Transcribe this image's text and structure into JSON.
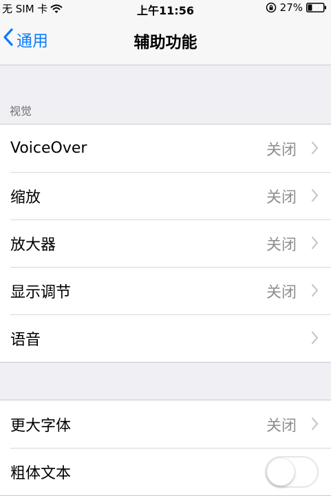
{
  "status_bar": {
    "carrier": "无 SIM 卡",
    "time": "上午11:56",
    "battery_percent": "27%",
    "battery_level": 0.27
  },
  "nav": {
    "back_label": "通用",
    "title": "辅助功能"
  },
  "section_header": "视觉",
  "vision_rows": [
    {
      "label": "VoiceOver",
      "value": "关闭"
    },
    {
      "label": "缩放",
      "value": "关闭"
    },
    {
      "label": "放大器",
      "value": "关闭"
    },
    {
      "label": "显示调节",
      "value": "关闭"
    },
    {
      "label": "语音",
      "value": ""
    }
  ],
  "text_rows": [
    {
      "label": "更大字体",
      "value": "关闭"
    },
    {
      "label": "粗体文本",
      "toggle_on": false
    }
  ],
  "colors": {
    "accent": "#0a7aff",
    "background": "#efeff4",
    "secondary_text": "#8e8e93"
  },
  "icons": [
    "wifi-icon",
    "rotation-lock-icon",
    "battery-icon",
    "chevron-left-icon",
    "chevron-right-icon"
  ]
}
